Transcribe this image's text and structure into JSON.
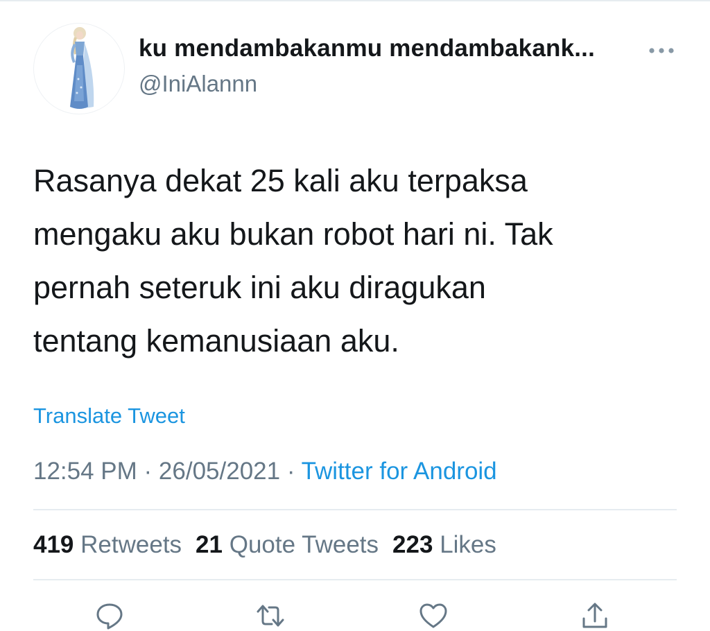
{
  "user": {
    "display_name": "ku mendambakanmu mendambakank...",
    "handle": "@IniAlannn",
    "avatar_icon": "ice-princess-avatar-icon"
  },
  "tweet": {
    "lines": [
      "Rasanya dekat 25 kali aku terpaksa",
      "mengaku aku bukan robot hari ni. Tak",
      "pernah seteruk ini aku diragukan",
      "tentang kemanusiaan aku."
    ],
    "translate_label": "Translate Tweet"
  },
  "meta": {
    "time": "12:54 PM",
    "separator": " · ",
    "date": "26/05/2021",
    "source": "Twitter for Android"
  },
  "stats": {
    "retweets": {
      "count": "419",
      "label": "Retweets"
    },
    "quotes": {
      "count": "21",
      "label": "Quote Tweets"
    },
    "likes": {
      "count": "223",
      "label": "Likes"
    }
  },
  "actions": [
    "reply-icon",
    "retweet-icon",
    "like-icon",
    "share-icon"
  ],
  "colors": {
    "link": "#1b95e0",
    "secondary_text": "#657786",
    "primary_text": "#14171a",
    "divider": "#e6ecf0"
  }
}
